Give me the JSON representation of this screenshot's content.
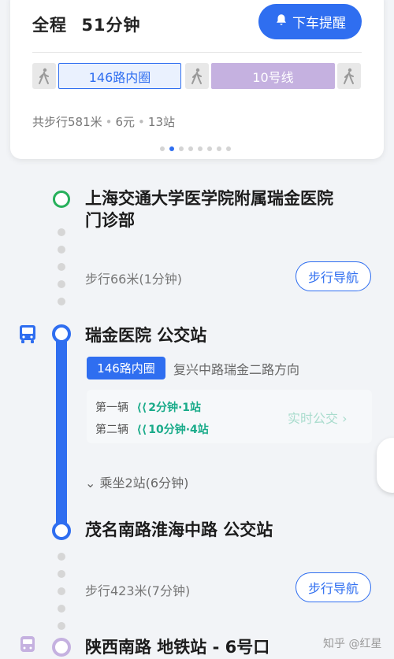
{
  "summary": {
    "total_label": "全程",
    "total_time": "51分钟",
    "remind_button": "下车提醒",
    "segments": {
      "bus": "146路内圈",
      "metro": "10号线"
    },
    "walk": "共步行581米",
    "fare": "6元",
    "stops": "13站",
    "page_total": 8,
    "page_active": 3
  },
  "timeline": {
    "origin": "上海交通大学医学院附属瑞金医院\n门诊部",
    "walk1": "步行66米(1分钟)",
    "walk_nav_label": "步行导航",
    "board_stop": "瑞金医院 公交站",
    "route_name": "146路内圈",
    "direction": "复兴中路瑞金二路方向",
    "arrivals": [
      {
        "label": "第一辆",
        "eta": "2分钟·1站"
      },
      {
        "label": "第二辆",
        "eta": "10分钟·4站"
      }
    ],
    "realtime_label": "实时公交",
    "ride_stops": "乘坐2站(6分钟)",
    "alight_stop": "茂名南路淮海中路 公交站",
    "walk2": "步行423米(7分钟)",
    "metro_stop": "陕西南路 地铁站 - 6号口"
  },
  "watermark": "知乎 @红星",
  "colors": {
    "primary": "#2f6ef0",
    "origin": "#27b05b",
    "metro": "#c5b1e0",
    "eta": "#1aab8a"
  }
}
